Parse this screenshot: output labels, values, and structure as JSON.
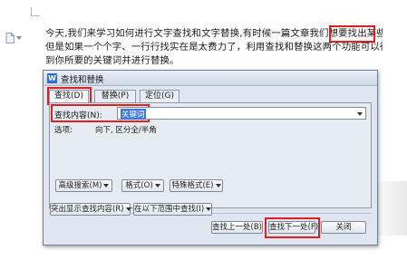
{
  "document": {
    "lines": [
      "今天,我们来学习如何进行文字查找和文字替换,有时候一篇文章我们想要找出某些关键词,",
      "但是如果一个个字、一行行找实在是太费力了，利用查找和替换这两个功能可以很快速地找",
      "到你所要的关键词并进行替换。"
    ],
    "highlighted_word": "关键词"
  },
  "dialog": {
    "title": "查找和替换",
    "app_icon_letter": "W",
    "tabs": [
      {
        "label": "查找(D)",
        "active": true
      },
      {
        "label": "替换(P)",
        "active": false
      },
      {
        "label": "定位(G)",
        "active": false
      }
    ],
    "find_label": "查找内容(N):",
    "find_value": "关键词",
    "options_label": "选项:",
    "options_value": "向下, 区分全/半角",
    "buttons": {
      "advanced": "高级搜索(M)",
      "format": "格式(O)",
      "special": "特殊格式(E)",
      "highlight_all": "突出显示查找内容(R)",
      "find_within": "在以下范围中查找(I)",
      "find_prev": "查找上一处(B)",
      "find_next": "查找下一处(F)",
      "close": "关闭"
    }
  },
  "colors": {
    "annotation": "#e02020",
    "selection": "#3d78d8",
    "dialog_bg": "#dfe6ef"
  }
}
